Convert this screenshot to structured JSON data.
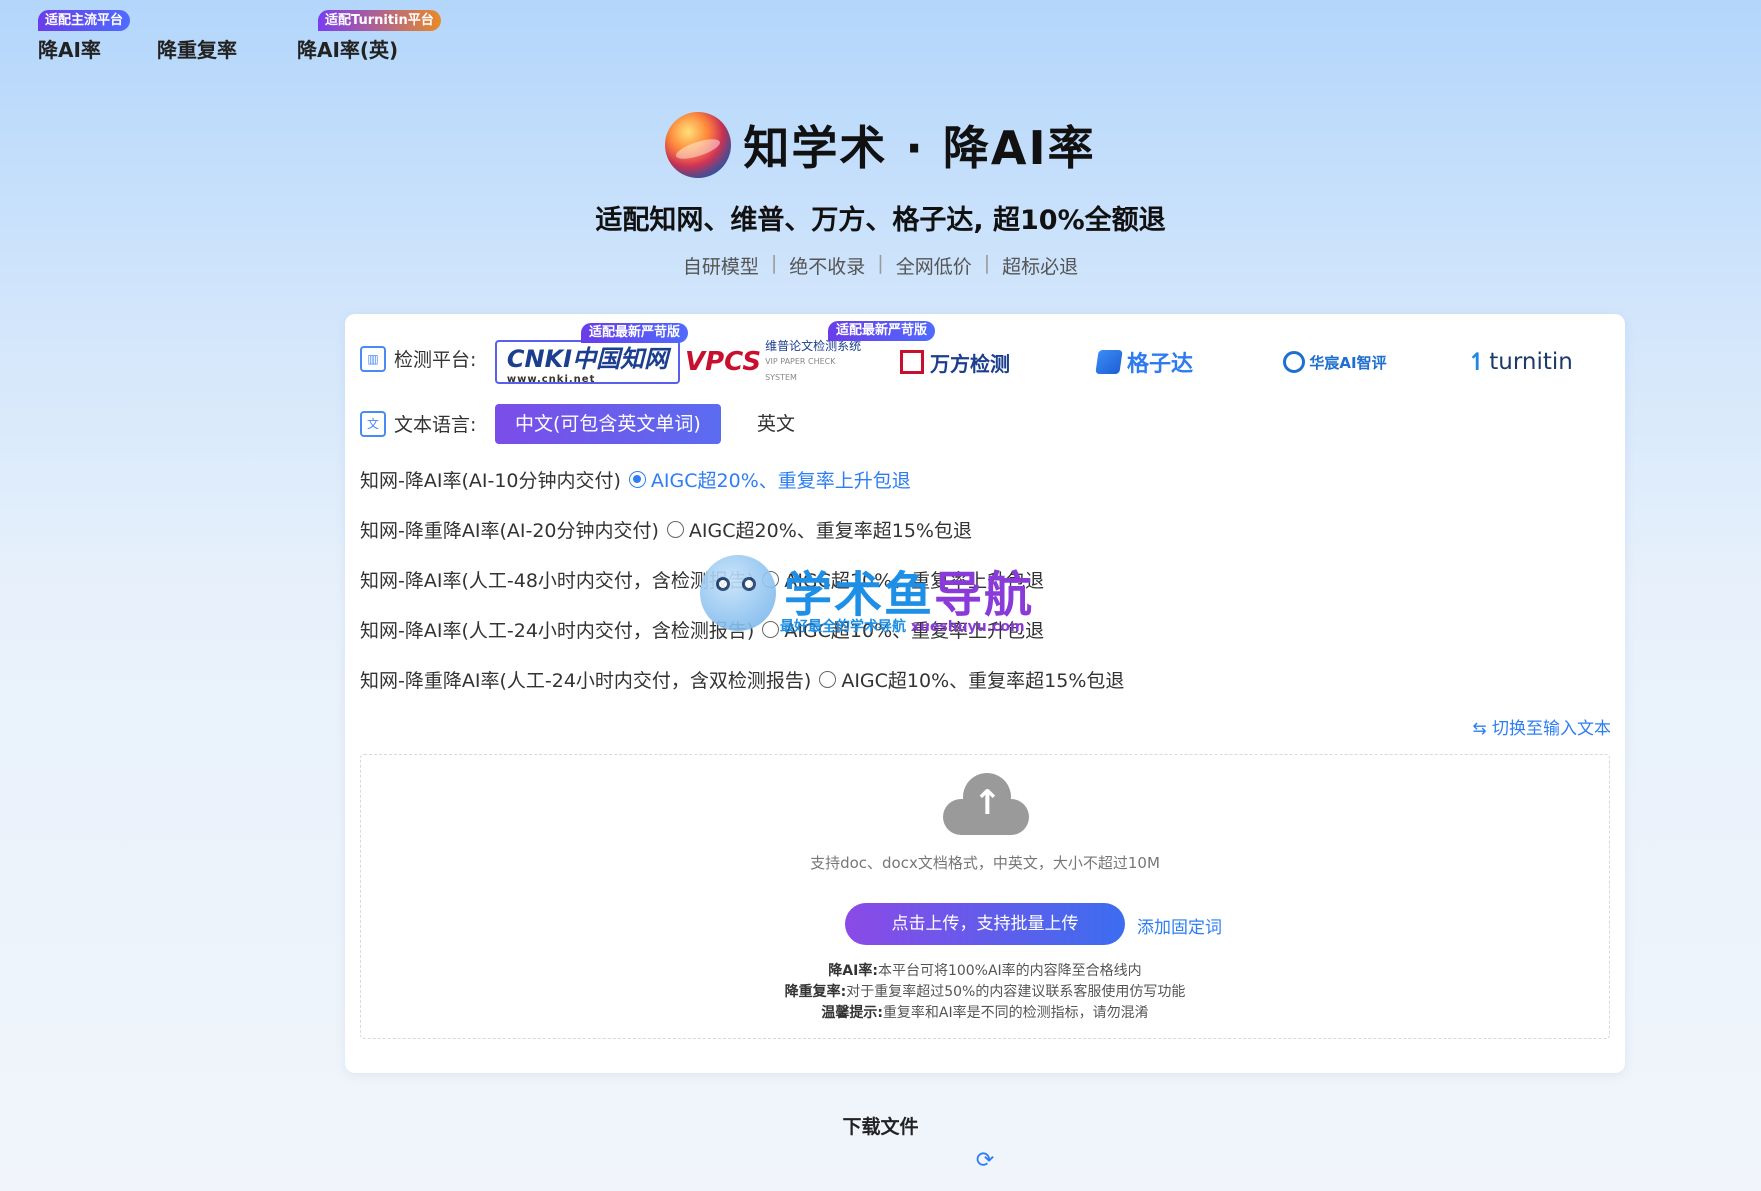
{
  "nav": {
    "items": [
      {
        "label": "降AI率",
        "tag": "适配主流平台"
      },
      {
        "label": "降重复率",
        "tag": ""
      },
      {
        "label": "降AI率(英)",
        "tag": "适配Turnitin平台"
      }
    ]
  },
  "hero": {
    "title": "知学术 · 降AI率",
    "subtitle": "适配知网、维普、万方、格子达, 超10%全额退",
    "features": [
      "自研模型",
      "绝不收录",
      "全网低价",
      "超标必退"
    ],
    "separator": "|"
  },
  "platform_row": {
    "label": "检测平台:",
    "platforms": [
      {
        "name": "CNKI 中国知网",
        "logo_main": "CNKI中国知网",
        "logo_sub": "www.cnki.net",
        "badge": "适配最新严苛版",
        "selected": true
      },
      {
        "name": "VPCS 维普论文检测系统",
        "logo_main": "VPCS",
        "logo_sub": "维普论文检测系统",
        "logo_sub2": "VIP PAPER CHECK SYSTEM",
        "badge": "适配最新严苛版",
        "selected": false
      },
      {
        "name": "万方检测",
        "logo_main": "万方检测",
        "badge": "",
        "selected": false
      },
      {
        "name": "格子达",
        "logo_main": "格子达",
        "badge": "",
        "selected": false
      },
      {
        "name": "华宸AI智评",
        "logo_main": "华宸AI智评",
        "badge": "",
        "selected": false
      },
      {
        "name": "turnitin",
        "logo_main": "turnitin",
        "badge": "",
        "selected": false
      }
    ]
  },
  "language_row": {
    "label": "文本语言:",
    "options": [
      "中文(可包含英文单词)",
      "英文"
    ],
    "selected": "中文(可包含英文单词)"
  },
  "service_options": [
    {
      "label": "知网-降AI率(AI-10分钟内交付)",
      "note": "AIGC超20%、重复率上升包退",
      "selected": true
    },
    {
      "label": "知网-降重降AI率(AI-20分钟内交付)",
      "note": "AIGC超20%、重复率超15%包退",
      "selected": false
    },
    {
      "label": "知网-降AI率(人工-48小时内交付，含检测报告)",
      "note": "AIGC超10%、重复率上升包退",
      "selected": false
    },
    {
      "label": "知网-降AI率(人工-24小时内交付，含检测报告)",
      "note": "AIGC超10%、重复率上升包退",
      "selected": false
    },
    {
      "label": "知网-降重降AI率(人工-24小时内交付，含双检测报告)",
      "note": "AIGC超10%、重复率超15%包退",
      "selected": false
    }
  ],
  "switch_link": "⇆ 切换至输入文本",
  "upload": {
    "hint": "支持doc、docx文档格式，中英文，大小不超过10M",
    "button": "点击上传，支持批量上传",
    "fixed_words_link": "添加固定词",
    "descriptions": [
      {
        "title": "降AI率:",
        "text": "本平台可将100%AI率的内容降至合格线内"
      },
      {
        "title": "降重复率:",
        "text": "对于重复率超过50%的内容建议联系客服使用仿写功能"
      },
      {
        "title": "温馨提示:",
        "text": "重复率和AI率是不同的检测指标，请勿混淆"
      }
    ]
  },
  "download": {
    "title": "下载文件"
  },
  "watermark": {
    "title_a": "学术鱼",
    "title_b": "导航",
    "sub_a": "最好最全的学术导航",
    "sub_b": "xueshuyu.com"
  },
  "colors": {
    "accent": "#2d7ef5",
    "purple": "#7b4de8"
  }
}
